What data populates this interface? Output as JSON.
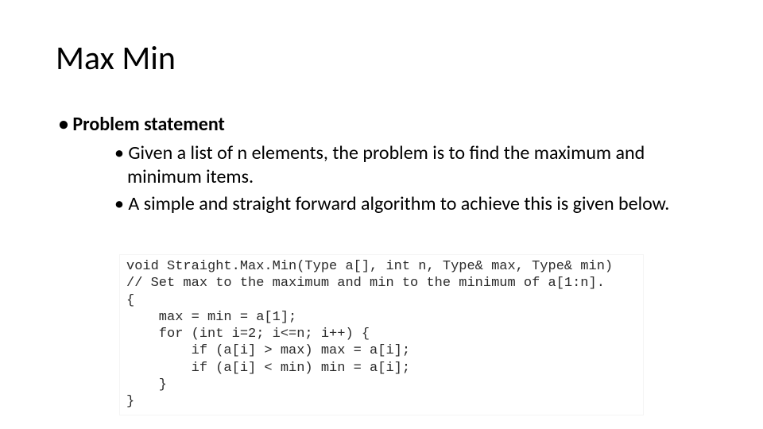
{
  "title": "Max Min",
  "problem_label": "Problem statement",
  "bullets": {
    "b1": "Given a list of n elements, the problem is to find the maximum and minimum items.",
    "b2": "A simple and straight forward algorithm to achieve this is given below."
  },
  "code": {
    "l1": "void Straight.Max.Min(Type a[], int n, Type& max, Type& min)",
    "l2": "// Set max to the maximum and min to the minimum of a[1:n].",
    "l3": "{",
    "l4": "    max = min = a[1];",
    "l5": "    for (int i=2; i<=n; i++) {",
    "l6": "        if (a[i] > max) max = a[i];",
    "l7": "        if (a[i] < min) min = a[i];",
    "l8": "    }",
    "l9": "}"
  }
}
